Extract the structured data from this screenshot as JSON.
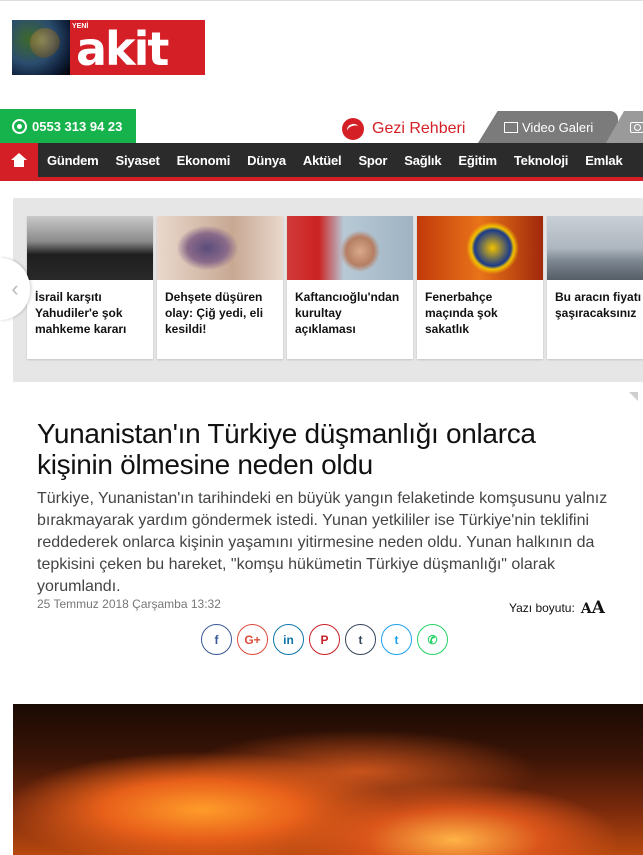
{
  "header": {
    "logo_small": "YENİ",
    "logo_main": "akit",
    "phone": "0553 313 94 23",
    "gezi_label": "Gezi Rehberi",
    "video_label": "Video Galeri"
  },
  "nav": {
    "items": [
      "Gündem",
      "Siyaset",
      "Ekonomi",
      "Dünya",
      "Aktüel",
      "Spor",
      "Sağlık",
      "Eğitim",
      "Teknoloji",
      "Emlak"
    ]
  },
  "slider": {
    "cards": [
      {
        "title": "İsrail karşıtı Yahudiler'e şok mahkeme kararı"
      },
      {
        "title": "Dehşete düşüren olay: Çiğ yedi, eli kesildi!"
      },
      {
        "title": "Kaftancıoğlu'ndan kurultay açıklaması"
      },
      {
        "title": "Fenerbahçe maçında şok sakatlık"
      },
      {
        "title": "Bu aracın fiyatı şaşıracaksınız"
      }
    ]
  },
  "article": {
    "headline": "Yunanistan'ın Türkiye düşmanlığı onlarca kişinin ölmesine neden oldu",
    "summary": "Türkiye, Yunanistan'ın tarihindeki en büyük yangın felaketinde komşusunu yalnız bırakmayarak yardım göndermek istedi. Yunan yetkililer ise Türkiye'nin teklifini reddederek onlarca kişinin yaşamını yitirmesine neden oldu. Yunan halkının da tepkisini çeken bu hareket, \"komşu hükümetin Türkiye düşmanlığı\" olarak yorumlandı.",
    "date": "25 Temmuz 2018 Çarşamba 13:32",
    "font_size_label": "Yazı boyutu:"
  },
  "share": [
    {
      "icon": "facebook-icon",
      "glyph": "f",
      "color": "#3b5998"
    },
    {
      "icon": "google-plus-icon",
      "glyph": "G+",
      "color": "#dd4b39"
    },
    {
      "icon": "linkedin-icon",
      "glyph": "in",
      "color": "#0e76a8"
    },
    {
      "icon": "pinterest-icon",
      "glyph": "P",
      "color": "#cb2027"
    },
    {
      "icon": "tumblr-icon",
      "glyph": "t",
      "color": "#35465c"
    },
    {
      "icon": "twitter-icon",
      "glyph": "t",
      "color": "#1da1f2"
    },
    {
      "icon": "whatsapp-icon",
      "glyph": "✆",
      "color": "#25d366"
    }
  ],
  "colors": {
    "brand_red": "#d41f26",
    "nav_dark": "#2b2b2b",
    "phone_green": "#16b24b"
  }
}
